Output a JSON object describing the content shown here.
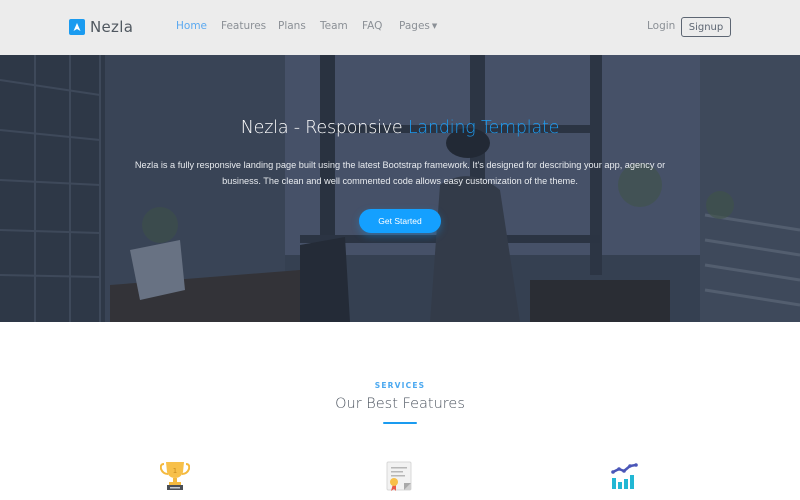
{
  "navbar": {
    "brand": {
      "name": "Nezla",
      "logo_icon": "navigation-arrow-icon",
      "logo_color": "#1a9bf0"
    },
    "links": [
      {
        "label": "Home",
        "active": true
      },
      {
        "label": "Features",
        "active": false
      },
      {
        "label": "Plans",
        "active": false
      },
      {
        "label": "Team",
        "active": false
      },
      {
        "label": "FAQ",
        "active": false
      },
      {
        "label": "Pages",
        "active": false,
        "dropdown": true
      }
    ],
    "login_label": "Login",
    "signup_label": "Signup"
  },
  "hero": {
    "title_main": "Nezla - Responsive ",
    "title_accent": "Landing Template",
    "description": "Nezla is a fully responsive landing page built using the latest Bootstrap framework. It's designed for describing your app, agency or business. The clean and well commented code allows easy customization of the theme.",
    "cta_label": "Get Started",
    "accent_color": "#1c9cf2"
  },
  "services": {
    "eyebrow": "SERVICES",
    "title": "Our Best Features",
    "features": [
      {
        "icon": "trophy-icon"
      },
      {
        "icon": "certificate-icon"
      },
      {
        "icon": "analytics-chart-icon"
      }
    ]
  }
}
